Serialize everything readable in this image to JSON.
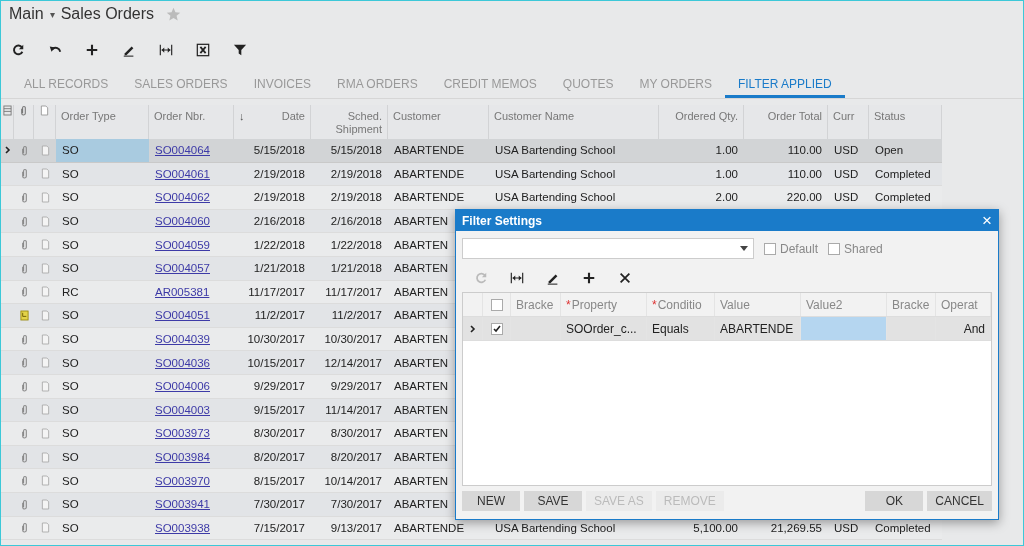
{
  "breadcrumb": {
    "parent": "Main",
    "caret": "▾",
    "title": "Sales Orders"
  },
  "tabs": [
    {
      "label": "ALL RECORDS",
      "selected": false
    },
    {
      "label": "SALES ORDERS",
      "selected": false
    },
    {
      "label": "INVOICES",
      "selected": false
    },
    {
      "label": "RMA ORDERS",
      "selected": false
    },
    {
      "label": "CREDIT MEMOS",
      "selected": false
    },
    {
      "label": "QUOTES",
      "selected": false
    },
    {
      "label": "MY ORDERS",
      "selected": false
    },
    {
      "label": "FILTER APPLIED",
      "selected": true
    }
  ],
  "table": {
    "columns": [
      {
        "label": "Order Type"
      },
      {
        "label": "Order Nbr."
      },
      {
        "label": "Date",
        "sort_mark": "↓"
      },
      {
        "label": "Sched. Shipment"
      },
      {
        "label": "Customer"
      },
      {
        "label": "Customer Name"
      },
      {
        "label": "Ordered Qty."
      },
      {
        "label": "Order Total"
      },
      {
        "label": "Curr"
      },
      {
        "label": "Status"
      }
    ],
    "rows": [
      {
        "selected": true,
        "note": false,
        "type": "SO",
        "nbr": "SO004064",
        "date": "5/15/2018",
        "sched": "5/15/2018",
        "customer": "ABARTENDE",
        "name": "USA Bartending School",
        "qty": "1.00",
        "total": "110.00",
        "curr": "USD",
        "status": "Open"
      },
      {
        "selected": false,
        "note": false,
        "type": "SO",
        "nbr": "SO004061",
        "date": "2/19/2018",
        "sched": "2/19/2018",
        "customer": "ABARTENDE",
        "name": "USA Bartending School",
        "qty": "1.00",
        "total": "110.00",
        "curr": "USD",
        "status": "Completed"
      },
      {
        "selected": false,
        "note": false,
        "type": "SO",
        "nbr": "SO004062",
        "date": "2/19/2018",
        "sched": "2/19/2018",
        "customer": "ABARTENDE",
        "name": "USA Bartending School",
        "qty": "2.00",
        "total": "220.00",
        "curr": "USD",
        "status": "Completed"
      },
      {
        "selected": false,
        "note": false,
        "type": "SO",
        "nbr": "SO004060",
        "date": "2/16/2018",
        "sched": "2/16/2018",
        "customer": "ABARTEN"
      },
      {
        "selected": false,
        "note": false,
        "type": "SO",
        "nbr": "SO004059",
        "date": "1/22/2018",
        "sched": "1/22/2018",
        "customer": "ABARTEN"
      },
      {
        "selected": false,
        "note": false,
        "type": "SO",
        "nbr": "SO004057",
        "date": "1/21/2018",
        "sched": "1/21/2018",
        "customer": "ABARTEN"
      },
      {
        "selected": false,
        "note": false,
        "type": "RC",
        "nbr": "AR005381",
        "date": "11/17/2017",
        "sched": "11/17/2017",
        "customer": "ABARTEN"
      },
      {
        "selected": false,
        "note": true,
        "type": "SO",
        "nbr": "SO004051",
        "date": "11/2/2017",
        "sched": "11/2/2017",
        "customer": "ABARTEN"
      },
      {
        "selected": false,
        "note": false,
        "type": "SO",
        "nbr": "SO004039",
        "date": "10/30/2017",
        "sched": "10/30/2017",
        "customer": "ABARTEN"
      },
      {
        "selected": false,
        "note": false,
        "type": "SO",
        "nbr": "SO004036",
        "date": "10/15/2017",
        "sched": "12/14/2017",
        "customer": "ABARTEN"
      },
      {
        "selected": false,
        "note": false,
        "type": "SO",
        "nbr": "SO004006",
        "date": "9/29/2017",
        "sched": "9/29/2017",
        "customer": "ABARTEN"
      },
      {
        "selected": false,
        "note": false,
        "type": "SO",
        "nbr": "SO004003",
        "date": "9/15/2017",
        "sched": "11/14/2017",
        "customer": "ABARTEN"
      },
      {
        "selected": false,
        "note": false,
        "type": "SO",
        "nbr": "SO003973",
        "date": "8/30/2017",
        "sched": "8/30/2017",
        "customer": "ABARTEN"
      },
      {
        "selected": false,
        "note": false,
        "type": "SO",
        "nbr": "SO003984",
        "date": "8/20/2017",
        "sched": "8/20/2017",
        "customer": "ABARTEN"
      },
      {
        "selected": false,
        "note": false,
        "type": "SO",
        "nbr": "SO003970",
        "date": "8/15/2017",
        "sched": "10/14/2017",
        "customer": "ABARTEN"
      },
      {
        "selected": false,
        "note": false,
        "type": "SO",
        "nbr": "SO003941",
        "date": "7/30/2017",
        "sched": "7/30/2017",
        "customer": "ABARTEN"
      },
      {
        "selected": false,
        "note": false,
        "type": "SO",
        "nbr": "SO003938",
        "date": "7/15/2017",
        "sched": "9/13/2017",
        "customer": "ABARTENDE",
        "name": "USA Bartending School",
        "qty": "5,100.00",
        "total": "21,269.55",
        "curr": "USD",
        "status": "Completed"
      }
    ]
  },
  "dialog": {
    "title": "Filter Settings",
    "close": "×",
    "options": [
      {
        "label": "Default",
        "checked": false
      },
      {
        "label": "Shared",
        "checked": false
      }
    ],
    "grid": {
      "select_all": false,
      "columns": [
        {
          "label": "Bracke"
        },
        {
          "label": "Property",
          "required_mark": "*"
        },
        {
          "label": "Conditio",
          "required_mark": "*"
        },
        {
          "label": "Value"
        },
        {
          "label": "Value2"
        },
        {
          "label": "Bracke"
        },
        {
          "label": "Operat"
        }
      ],
      "rows": [
        {
          "selected": true,
          "checked": true,
          "property": "SOOrder_c...",
          "condition": "Equals",
          "value": "ABARTENDE",
          "operator": "And"
        }
      ]
    },
    "buttons": [
      {
        "label": "NEW",
        "disabled": false
      },
      {
        "label": "SAVE",
        "disabled": false
      },
      {
        "label": "SAVE AS",
        "disabled": true
      },
      {
        "label": "REMOVE",
        "disabled": true
      }
    ],
    "actions": [
      {
        "label": "OK"
      },
      {
        "label": "CANCEL"
      }
    ]
  }
}
